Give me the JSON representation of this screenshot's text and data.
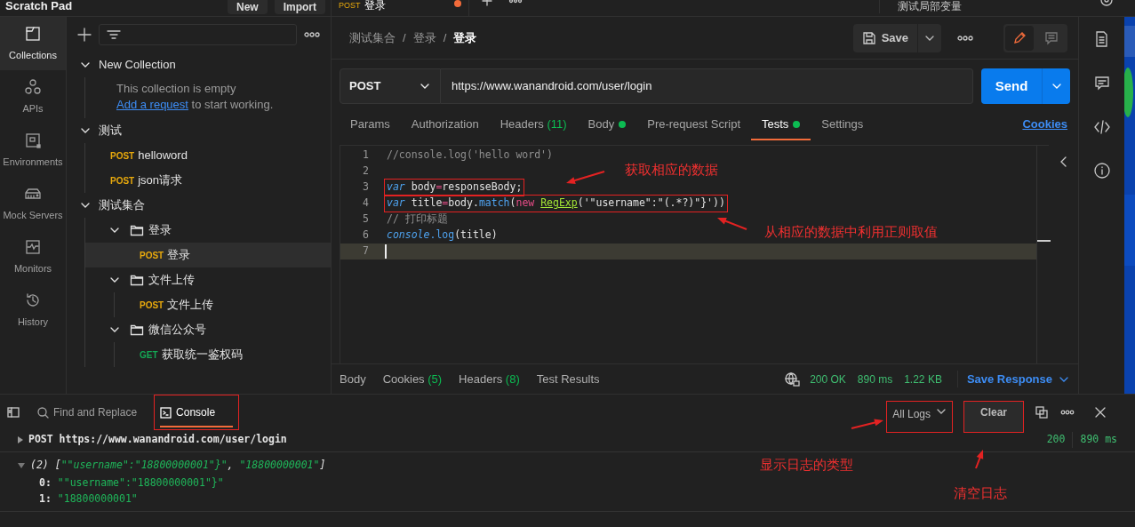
{
  "top_bar": {
    "workspace": "Scratch Pad",
    "buttons": [
      "New",
      "Import"
    ],
    "tab": {
      "method": "POST",
      "name": "登录",
      "unsaved": true
    },
    "environment": "测试局部变量"
  },
  "nav_rail": [
    {
      "label": "Collections",
      "selected": true
    },
    {
      "label": "APIs",
      "selected": false
    },
    {
      "label": "Environments",
      "selected": false
    },
    {
      "label": "Mock Servers",
      "selected": false
    },
    {
      "label": "Monitors",
      "selected": false
    },
    {
      "label": "History",
      "selected": false
    }
  ],
  "sidebar": {
    "tree": [
      {
        "kind": "collection",
        "name": "New Collection",
        "expanded": true,
        "children": [
          {
            "kind": "note",
            "text": "This collection is empty",
            "link": "Add a request",
            "rest": "to start working."
          }
        ]
      },
      {
        "kind": "collection",
        "name": "测试",
        "expanded": true,
        "children": [
          {
            "kind": "request",
            "method": "POST",
            "color": "#e8a90c",
            "name": "helloword",
            "selected": false
          },
          {
            "kind": "request",
            "method": "POST",
            "color": "#e8a90c",
            "name": "json请求",
            "selected": false
          }
        ]
      },
      {
        "kind": "collection",
        "name": "测试集合",
        "expanded": true,
        "children": [
          {
            "kind": "folder",
            "name": "登录",
            "expanded": true,
            "children": [
              {
                "kind": "request",
                "method": "POST",
                "color": "#e8a90c",
                "name": "登录",
                "selected": true
              }
            ]
          },
          {
            "kind": "folder",
            "name": "文件上传",
            "expanded": true,
            "children": [
              {
                "kind": "request",
                "method": "POST",
                "color": "#e8a90c",
                "name": "文件上传",
                "selected": false
              }
            ]
          },
          {
            "kind": "folder",
            "name": "微信公众号",
            "expanded": true,
            "children": [
              {
                "kind": "request",
                "method": "GET",
                "color": "#14a855",
                "name": "获取统一鉴权码",
                "selected": false
              }
            ]
          }
        ]
      }
    ]
  },
  "request": {
    "breadcrumb": [
      "测试集合",
      "登录",
      "登录"
    ],
    "separator": "/",
    "save_label": "Save",
    "method": "POST",
    "url": "https://www.wanandroid.com/user/login",
    "send_label": "Send",
    "tabs": [
      {
        "label": "Params",
        "selected": false
      },
      {
        "label": "Authorization",
        "selected": false
      },
      {
        "label": "Headers",
        "count": "(11)",
        "selected": false
      },
      {
        "label": "Body",
        "dot": true,
        "selected": false
      },
      {
        "label": "Pre-request Script",
        "selected": false
      },
      {
        "label": "Tests",
        "dot": true,
        "selected": true
      },
      {
        "label": "Settings",
        "selected": false
      }
    ],
    "cookies_link": "Cookies",
    "code_lines": [
      {
        "number": "1",
        "current": false,
        "boxed": false,
        "tokens": [
          {
            "kind": "comment",
            "text": "//console.log('hello word')"
          }
        ]
      },
      {
        "number": "2",
        "current": false,
        "boxed": false
      },
      {
        "number": "3",
        "current": false,
        "boxed": true,
        "tokens": [
          {
            "kind": "keyword",
            "text": "var"
          },
          {
            "kind": "plain",
            "text": " body"
          },
          {
            "kind": "operator",
            "text": "="
          },
          {
            "kind": "plain",
            "text": "responseBody;"
          }
        ]
      },
      {
        "number": "4",
        "current": false,
        "boxed": true,
        "tokens": [
          {
            "kind": "keyword",
            "text": "var"
          },
          {
            "kind": "plain",
            "text": " title"
          },
          {
            "kind": "operator",
            "text": "="
          },
          {
            "kind": "plain",
            "text": "body."
          },
          {
            "kind": "method",
            "text": "match"
          },
          {
            "kind": "plain",
            "text": "("
          },
          {
            "kind": "operator",
            "text": "new "
          },
          {
            "kind": "class",
            "text": "RegExp"
          },
          {
            "kind": "plain",
            "text": "('\"username\":\"(.*?)\"}'))"
          }
        ]
      },
      {
        "number": "5",
        "current": false,
        "boxed": false,
        "tokens": [
          {
            "kind": "comment",
            "text": "// 打印标题"
          }
        ]
      },
      {
        "number": "6",
        "current": false,
        "boxed": false,
        "tokens": [
          {
            "kind": "keyword",
            "text": "console"
          },
          {
            "kind": "method",
            "text": ".log"
          },
          {
            "kind": "plain",
            "text": "(title)"
          }
        ]
      },
      {
        "number": "7",
        "current": true,
        "boxed": false
      }
    ]
  },
  "response": {
    "tabs": [
      {
        "label": "Body",
        "selected": false
      },
      {
        "label": "Cookies",
        "count": "(5)",
        "selected": false
      },
      {
        "label": "Headers",
        "count": "(8)",
        "selected": false
      },
      {
        "label": "Test Results",
        "selected": false
      }
    ],
    "status": "200 OK",
    "time": "890 ms",
    "size": "1.22 KB",
    "save_label": "Save Response"
  },
  "console": {
    "tabs": [
      {
        "label": "Find and Replace",
        "selected": false,
        "highlighted": false
      },
      {
        "label": "Console",
        "selected": true,
        "highlighted": true
      }
    ],
    "filter": {
      "label": "All Logs",
      "highlighted": true
    },
    "clear": {
      "label": "Clear",
      "highlighted": true
    },
    "entries": [
      {
        "expanded": false,
        "tokens": [
          {
            "kind": "plain",
            "text": "POST https://www.wanandroid.com/user/login"
          }
        ],
        "status": "200",
        "time": "890 ms"
      },
      {
        "expanded": true,
        "tokens": [
          {
            "kind": "count",
            "text": "(2)"
          },
          {
            "kind": "plain",
            "text": " ["
          },
          {
            "kind": "string",
            "text": "\"\"username\":\"18800000001\"}\""
          },
          {
            "kind": "plain",
            "text": ", "
          },
          {
            "kind": "string",
            "text": "\"18800000001\""
          },
          {
            "kind": "plain",
            "text": "]"
          }
        ],
        "children": [
          {
            "key": "0:",
            "value": "\"\"username\":\"18800000001\"}\""
          },
          {
            "key": "1:",
            "value": "\"18800000001\""
          }
        ]
      }
    ]
  },
  "annotations": [
    {
      "text": "获取相应的数据"
    },
    {
      "text": "从相应的数据中利用正则取值"
    },
    {
      "text": "显示日志的类型"
    },
    {
      "text": "清空日志"
    }
  ]
}
